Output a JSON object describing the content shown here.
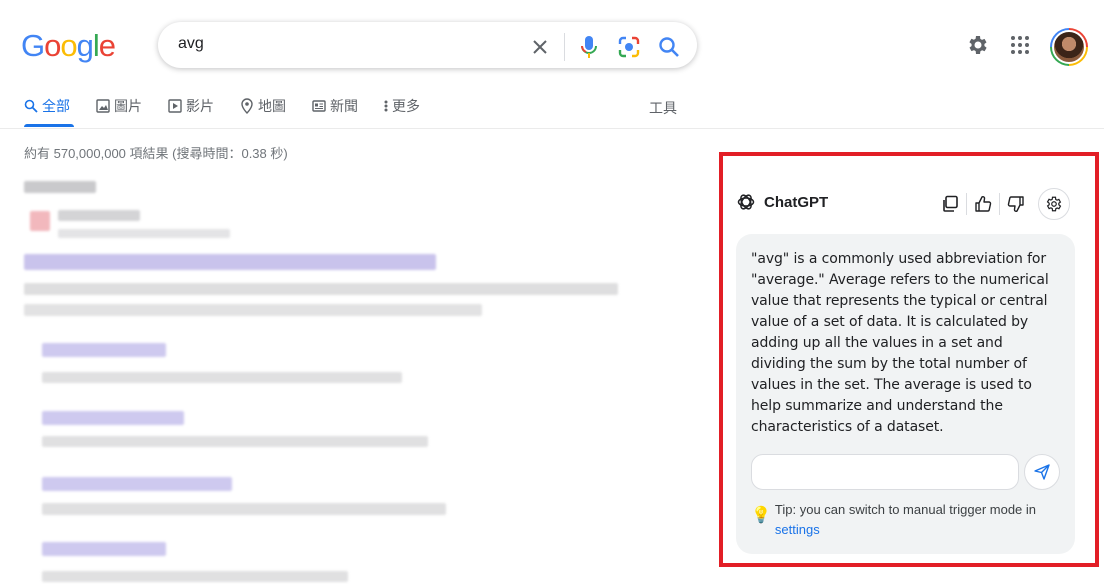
{
  "logo": {
    "letters": [
      "G",
      "o",
      "o",
      "g",
      "l",
      "e"
    ],
    "colors": [
      "#4285f4",
      "#ea4335",
      "#fbbc05",
      "#4285f4",
      "#34a853",
      "#ea4335"
    ]
  },
  "search": {
    "query": "avg"
  },
  "tabs": [
    {
      "label": "全部",
      "icon": "search-icon",
      "active": true
    },
    {
      "label": "圖片",
      "icon": "image-icon"
    },
    {
      "label": "影片",
      "icon": "video-icon"
    },
    {
      "label": "地圖",
      "icon": "map-pin-icon"
    },
    {
      "label": "新聞",
      "icon": "news-icon"
    },
    {
      "label": "更多",
      "icon": "more-vert-icon"
    }
  ],
  "tools_label": "工具",
  "stats": "約有 570,000,000 項結果 (搜尋時間：0.38 秒)",
  "chatgpt": {
    "title": "ChatGPT",
    "answer": "\"avg\" is a commonly used abbreviation for \"average.\" Average refers to the numerical value that represents the typical or central value of a set of data. It is calculated by adding up all the values in a set and dividing the sum by the total number of values in the set. The average is used to help summarize and understand the characteristics of a dataset.",
    "input_placeholder": "",
    "tip_text": "Tip: you can switch to manual trigger mode in",
    "tip_link": "settings"
  },
  "colors": {
    "accent": "#1a73e8",
    "highlight_border": "#e21e26",
    "card_bg": "#f1f3f4"
  }
}
